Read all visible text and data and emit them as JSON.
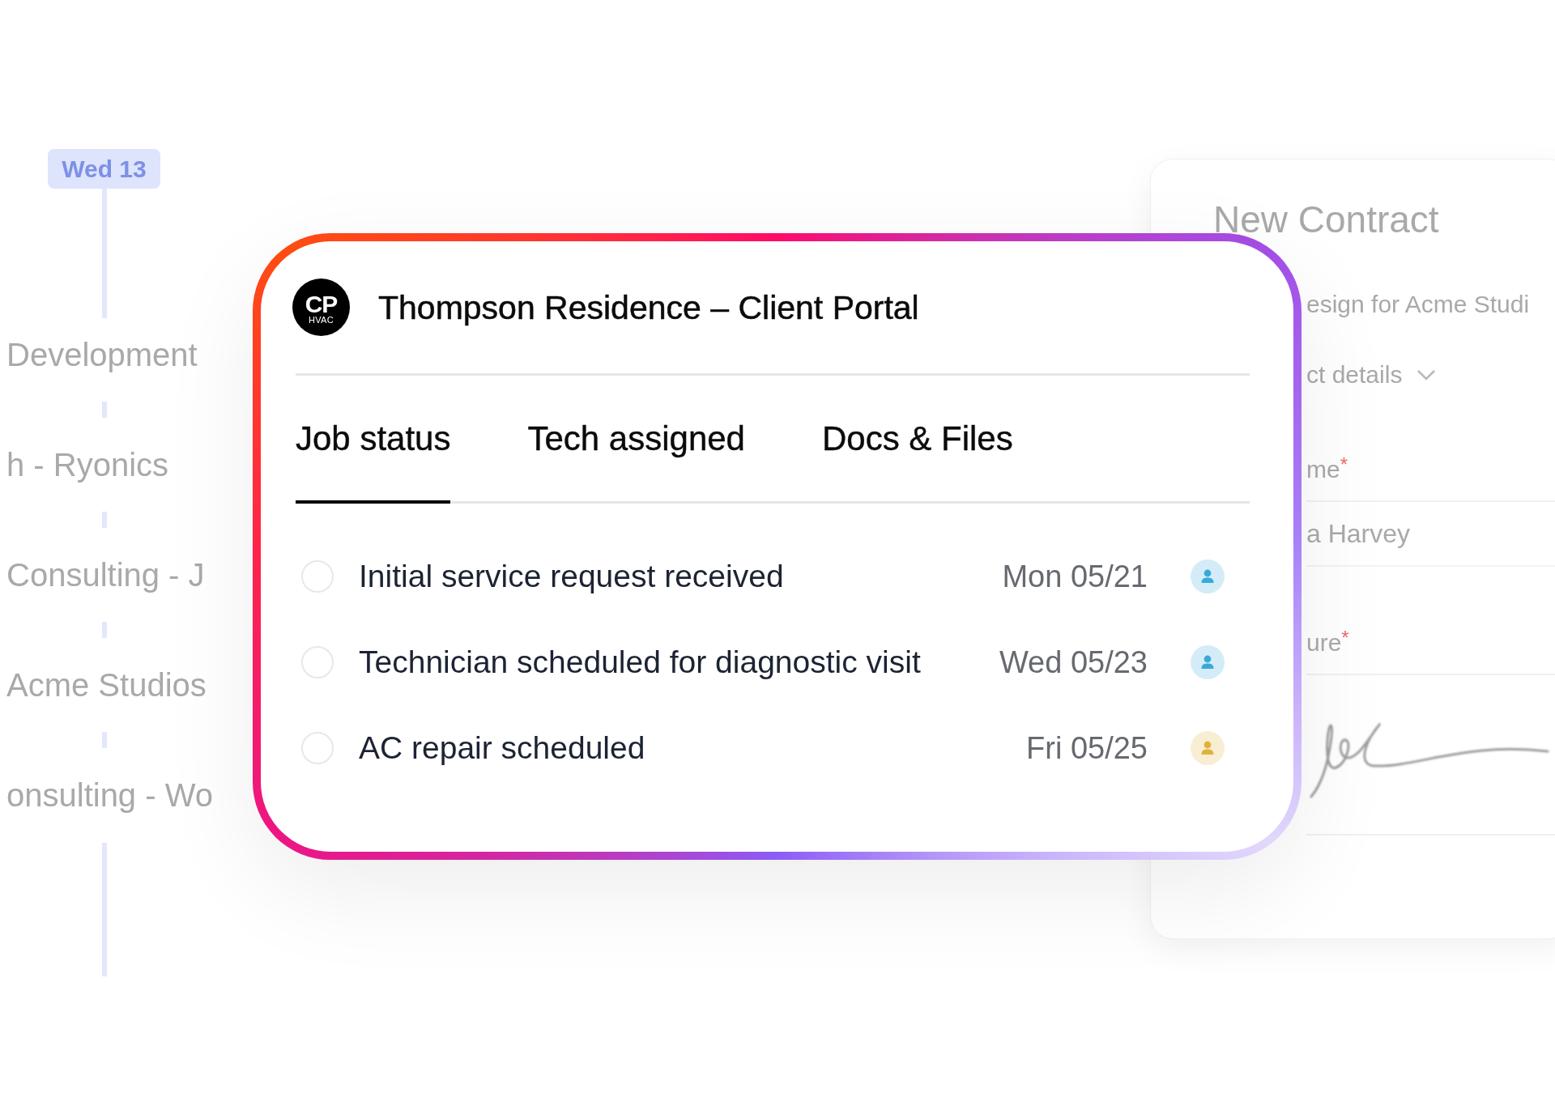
{
  "background": {
    "timeline": {
      "badge": "Wed 13",
      "items": [
        "Development",
        "h - Ryonics",
        "Consulting - J",
        "Acme Studios",
        "onsulting - Wo"
      ]
    },
    "contract": {
      "title": "New Contract",
      "subtitle": "esign for Acme Studi",
      "section": "ct details",
      "fields": [
        {
          "kind": "text",
          "label": "me",
          "mark": "*",
          "value": "a Harvey"
        },
        {
          "kind": "signature",
          "label": "ure",
          "mark": "*"
        }
      ]
    }
  },
  "portal": {
    "logo": {
      "initials": "CP",
      "subtitle": "HVAC"
    },
    "title": "Thompson Residence – Client Portal",
    "tabs": [
      {
        "label": "Job status",
        "selected": true
      },
      {
        "label": "Tech assigned",
        "selected": false
      },
      {
        "label": "Docs & Files",
        "selected": false
      }
    ],
    "tasks": [
      {
        "text": "Initial service request received",
        "checked": false,
        "date": "Mon 05/21",
        "color": "#3aa9da"
      },
      {
        "text": "Technician scheduled for diagnostic visit",
        "checked": false,
        "date": "Wed 05/23",
        "color": "#3aa9da"
      },
      {
        "text": "AC repair scheduled",
        "checked": false,
        "date": "Fri 05/25",
        "color": "#e0b23c"
      }
    ]
  }
}
